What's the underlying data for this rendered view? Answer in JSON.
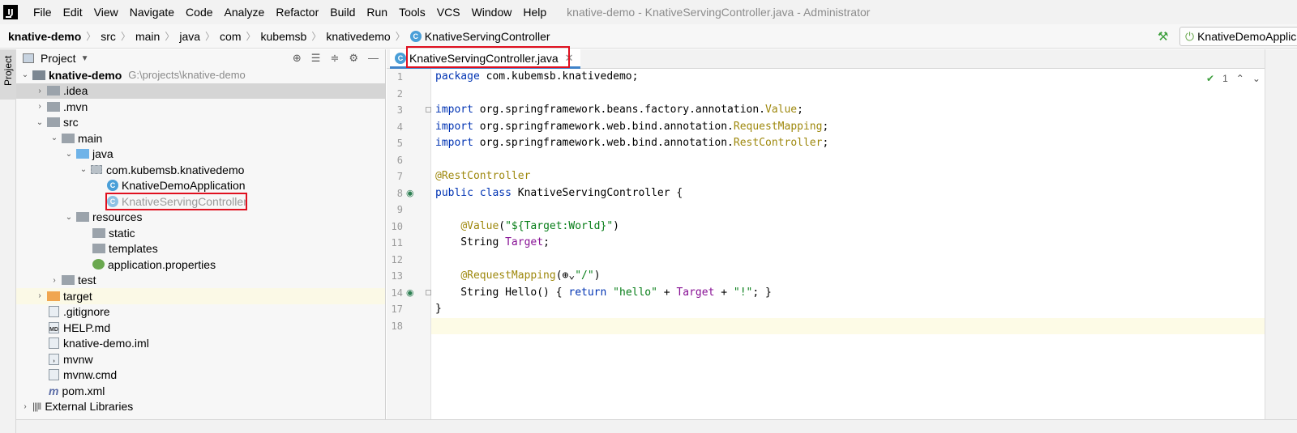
{
  "menubar": {
    "logo": "IJ",
    "items": [
      "File",
      "Edit",
      "View",
      "Navigate",
      "Code",
      "Analyze",
      "Refactor",
      "Build",
      "Run",
      "Tools",
      "VCS",
      "Window",
      "Help"
    ],
    "window_title": "knative-demo - KnativeServingController.java - Administrator"
  },
  "breadcrumb": {
    "items": [
      "knative-demo",
      "src",
      "main",
      "java",
      "com",
      "kubemsb",
      "knativedemo",
      "KnativeServingController"
    ]
  },
  "toolbar": {
    "run_config": "KnativeDemoApplic"
  },
  "project_panel": {
    "title": "Project",
    "tab_label": "Project",
    "tree": [
      {
        "label": "knative-demo",
        "path": "G:\\projects\\knative-demo",
        "icon": "module-folder-icon"
      },
      {
        "label": ".idea",
        "icon": "folder-icon"
      },
      {
        "label": ".mvn",
        "icon": "folder-icon"
      },
      {
        "label": "src",
        "icon": "folder-icon"
      },
      {
        "label": "main",
        "icon": "folder-icon"
      },
      {
        "label": "java",
        "icon": "source-folder-icon"
      },
      {
        "label": "com.kubemsb.knativedemo",
        "icon": "package-icon"
      },
      {
        "label": "KnativeDemoApplication",
        "icon": "spring-class-icon"
      },
      {
        "label": "KnativeServingController",
        "icon": "class-icon"
      },
      {
        "label": "resources",
        "icon": "resources-folder-icon"
      },
      {
        "label": "static",
        "icon": "folder-icon"
      },
      {
        "label": "templates",
        "icon": "folder-icon"
      },
      {
        "label": "application.properties",
        "icon": "properties-icon"
      },
      {
        "label": "test",
        "icon": "folder-icon"
      },
      {
        "label": "target",
        "icon": "excluded-folder-icon"
      },
      {
        "label": ".gitignore",
        "icon": "gitignore-icon"
      },
      {
        "label": "HELP.md",
        "icon": "markdown-icon"
      },
      {
        "label": "knative-demo.iml",
        "icon": "iml-icon"
      },
      {
        "label": "mvnw",
        "icon": "script-icon"
      },
      {
        "label": "mvnw.cmd",
        "icon": "script-icon"
      },
      {
        "label": "pom.xml",
        "icon": "maven-icon"
      },
      {
        "label": "External Libraries",
        "icon": "library-icon"
      }
    ]
  },
  "editor": {
    "tab_label": "KnativeServingController.java",
    "inspection_count": "1",
    "lines": [
      {
        "num": "1",
        "code": [
          [
            "kw",
            "package"
          ],
          [
            "pk",
            " com.kubemsb.knativedemo;"
          ]
        ]
      },
      {
        "num": "2",
        "code": []
      },
      {
        "num": "3",
        "code": [
          [
            "kw",
            "import"
          ],
          [
            "pk",
            " org.springframework.beans.factory.annotation."
          ],
          [
            "ann",
            "Value"
          ],
          [
            "pk",
            ";"
          ]
        ]
      },
      {
        "num": "4",
        "code": [
          [
            "kw",
            "import"
          ],
          [
            "pk",
            " org.springframework.web.bind.annotation."
          ],
          [
            "ann",
            "RequestMapping"
          ],
          [
            "pk",
            ";"
          ]
        ]
      },
      {
        "num": "5",
        "code": [
          [
            "kw",
            "import"
          ],
          [
            "pk",
            " org.springframework.web.bind.annotation."
          ],
          [
            "ann",
            "RestController"
          ],
          [
            "pk",
            ";"
          ]
        ]
      },
      {
        "num": "6",
        "code": []
      },
      {
        "num": "7",
        "code": [
          [
            "ann",
            "@RestController"
          ]
        ]
      },
      {
        "num": "8",
        "code": [
          [
            "kw",
            "public class"
          ],
          [
            "pk",
            " KnativeServingController {"
          ]
        ]
      },
      {
        "num": "9",
        "code": []
      },
      {
        "num": "10",
        "code": [
          [
            "pk",
            "    "
          ],
          [
            "ann",
            "@Value"
          ],
          [
            "pk",
            "("
          ],
          [
            "str",
            "\"${Target:World}\""
          ],
          [
            "pk",
            ")"
          ]
        ]
      },
      {
        "num": "11",
        "code": [
          [
            "pk",
            "    String "
          ],
          [
            "fld",
            "Target"
          ],
          [
            "pk",
            ";"
          ]
        ]
      },
      {
        "num": "12",
        "code": []
      },
      {
        "num": "13",
        "code": [
          [
            "pk",
            "    "
          ],
          [
            "ann",
            "@RequestMapping"
          ],
          [
            "pk",
            "(⊕⌄"
          ],
          [
            "str",
            "\"/\""
          ],
          [
            "pk",
            ")"
          ]
        ]
      },
      {
        "num": "14",
        "code": [
          [
            "pk",
            "    String Hello() { "
          ],
          [
            "kw",
            "return"
          ],
          [
            "pk",
            " "
          ],
          [
            "str",
            "\"hello\""
          ],
          [
            "pk",
            " + "
          ],
          [
            "fld",
            "Target"
          ],
          [
            "pk",
            " + "
          ],
          [
            "str",
            "\"!\""
          ],
          [
            "pk",
            "; }"
          ]
        ]
      },
      {
        "num": "17",
        "code": [
          [
            "pk",
            "}"
          ]
        ]
      },
      {
        "num": "18",
        "code": []
      }
    ]
  }
}
